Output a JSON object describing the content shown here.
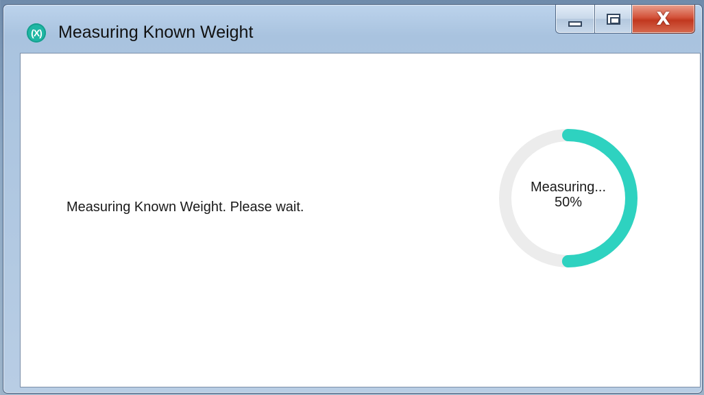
{
  "window": {
    "title": "Measuring Known Weight",
    "icon": "maxim-logo-icon",
    "accent_color": "#2ed2c0"
  },
  "caption_buttons": {
    "minimize": "minimize-icon",
    "maximize": "maximize-icon",
    "close": "close-icon",
    "close_glyph": "X"
  },
  "content": {
    "message": "Measuring Known Weight. Please wait."
  },
  "progress": {
    "label": "Measuring...",
    "percent_text": "50%",
    "value": 0.5,
    "track_color": "#ececec",
    "fill_color": "#2ed2c0"
  }
}
